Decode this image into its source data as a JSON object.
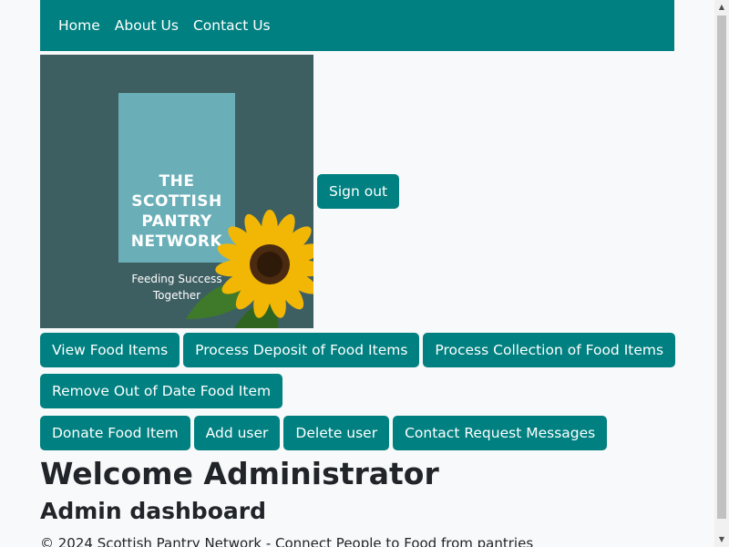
{
  "nav": {
    "items": [
      {
        "label": "Home"
      },
      {
        "label": "About Us"
      },
      {
        "label": "Contact Us"
      }
    ]
  },
  "logo": {
    "title": "THE\nSCOTTISH\nPANTRY\nNETWORK",
    "tagline": "Feeding Success\nTogether"
  },
  "signout_label": "Sign out",
  "actions": {
    "row1": [
      {
        "label": "View Food Items"
      },
      {
        "label": "Process Deposit of Food Items"
      },
      {
        "label": "Process Collection of Food Items"
      }
    ],
    "row2": [
      {
        "label": "Remove Out of Date Food Item"
      }
    ],
    "row3": [
      {
        "label": "Donate Food Item"
      },
      {
        "label": "Add user"
      },
      {
        "label": "Delete user"
      },
      {
        "label": "Contact Request Messages"
      }
    ]
  },
  "welcome": "Welcome Administrator",
  "dashboard_title": "Admin dashboard",
  "footer": "© 2024 Scottish Pantry Network - Connect People to Food from pantries",
  "colors": {
    "primary": "#008080",
    "logo_bg": "#3e5f62",
    "logo_card": "#6aafb8",
    "page_bg": "#f8f9fa"
  }
}
